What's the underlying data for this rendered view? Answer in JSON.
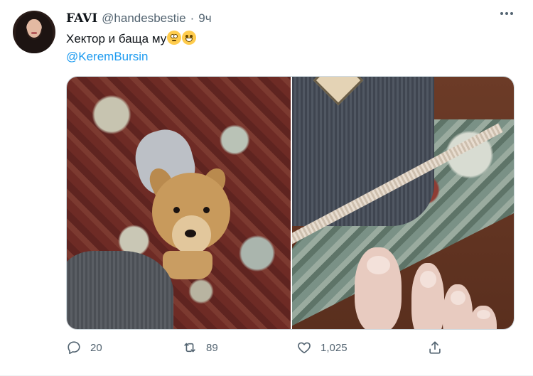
{
  "tweet": {
    "display_name": "FAVI",
    "handle": "@handesbestie",
    "separator": "·",
    "time": "9ч",
    "text": "Хектор и баща му",
    "emojis": [
      "face-with-rolling-eyes",
      "grinning-face"
    ],
    "mention": "@KeremBursin",
    "media": [
      {
        "description_icon": "photo-dog-on-rug"
      },
      {
        "description_icon": "photo-foot-on-rug"
      }
    ]
  },
  "actions": {
    "replies": "20",
    "retweets": "89",
    "likes": "1,025"
  },
  "colors": {
    "accent": "#1d9bf0",
    "text": "#0f1419",
    "secondary": "#536471"
  }
}
